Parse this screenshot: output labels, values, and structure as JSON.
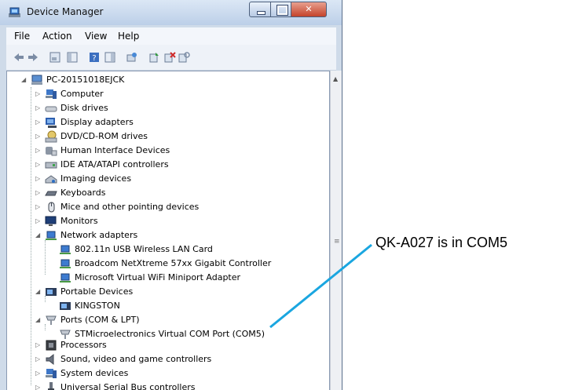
{
  "window": {
    "title": "Device Manager"
  },
  "menu": [
    "File",
    "Action",
    "View",
    "Help"
  ],
  "toolbar_icons": [
    "back-icon",
    "forward-icon",
    "properties-view-icon",
    "show-hide-console-tree-icon",
    "help-icon",
    "show-hide-action-pane-icon",
    "scan-hardware-changes-icon",
    "update-driver-icon",
    "uninstall-icon",
    "disable-icon"
  ],
  "tree": {
    "root": "PC-20151018EJCK",
    "items": [
      {
        "label": "Computer",
        "expanded": false
      },
      {
        "label": "Disk drives",
        "expanded": false
      },
      {
        "label": "Display adapters",
        "expanded": false
      },
      {
        "label": "DVD/CD-ROM drives",
        "expanded": false
      },
      {
        "label": "Human Interface Devices",
        "expanded": false
      },
      {
        "label": "IDE ATA/ATAPI controllers",
        "expanded": false
      },
      {
        "label": "Imaging devices",
        "expanded": false
      },
      {
        "label": "Keyboards",
        "expanded": false
      },
      {
        "label": "Mice and other pointing devices",
        "expanded": false
      },
      {
        "label": "Monitors",
        "expanded": false
      },
      {
        "label": "Network adapters",
        "expanded": true,
        "children": [
          "802.11n USB Wireless LAN Card",
          "Broadcom NetXtreme 57xx Gigabit Controller",
          "Microsoft Virtual WiFi Miniport Adapter"
        ]
      },
      {
        "label": "Portable Devices",
        "expanded": true,
        "children": [
          "KINGSTON"
        ]
      },
      {
        "label": "Ports (COM & LPT)",
        "expanded": true,
        "children": [
          "STMicroelectronics Virtual COM Port (COM5)"
        ]
      },
      {
        "label": "Processors",
        "expanded": false
      },
      {
        "label": "Sound, video and game controllers",
        "expanded": false
      },
      {
        "label": "System devices",
        "expanded": false
      },
      {
        "label": "Universal Serial Bus controllers",
        "expanded": false
      }
    ]
  },
  "annotation": {
    "text": "QK-A027 is in COM5",
    "color": "#1aa6e0"
  }
}
